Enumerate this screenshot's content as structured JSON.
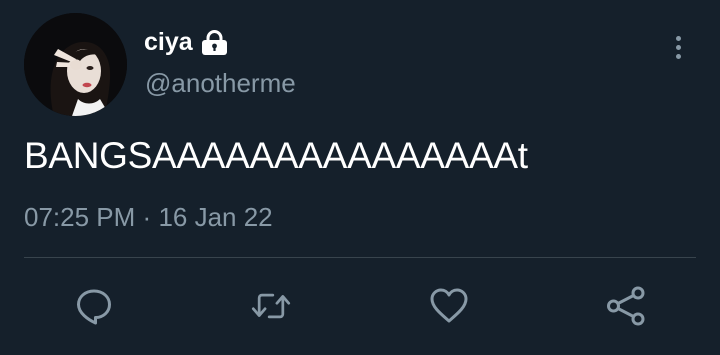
{
  "tweet": {
    "display_name": "ciya",
    "handle": "@anotherme",
    "text": "BANGSAAAAAAAAAAAAAAAt",
    "time": "07:25 PM",
    "separator": "·",
    "date": "16 Jan 22"
  },
  "icons": {
    "protected": "lock-icon",
    "more": "more-vertical-icon",
    "reply": "reply-icon",
    "retweet": "retweet-icon",
    "like": "heart-icon",
    "share": "share-icon"
  },
  "colors": {
    "background": "#15202b",
    "secondary_text": "#8899a6",
    "divider": "#38444d",
    "primary_text": "#ffffff"
  }
}
